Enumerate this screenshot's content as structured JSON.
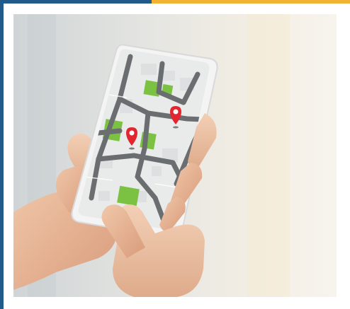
{
  "colors": {
    "frame_blue": "#1f5a8a",
    "frame_yellow": "#f2b233",
    "map_green": "#7cc242",
    "map_road": "#6b6e70",
    "map_block": "#e9eaea",
    "pin_red": "#e2262f",
    "skin": "#e9b99a"
  },
  "icons": [
    "map-pin-icon",
    "map-pin-icon"
  ],
  "image_subject": ""
}
